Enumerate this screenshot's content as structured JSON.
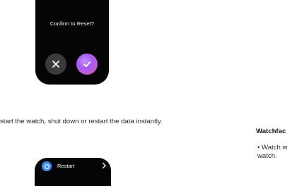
{
  "dialog": {
    "title": "Confirm to Reset?",
    "cancel_icon": "close-icon",
    "confirm_icon": "check-icon"
  },
  "body": {
    "description": "start the watch, shut down or restart the data instantly."
  },
  "watchface": {
    "heading": "Watchfac",
    "bullet": "• Watch w watch."
  },
  "menu": {
    "restart_label": "Restart",
    "restart_icon": "restart-icon",
    "chevron_icon": "chevron-right-icon"
  },
  "colors": {
    "screen": "#050505",
    "cancel_button": "#3b3b3b",
    "confirm_gradient_start": "#a55cf0",
    "confirm_gradient_end": "#e15ab2",
    "restart_icon": "#3f8df5"
  }
}
